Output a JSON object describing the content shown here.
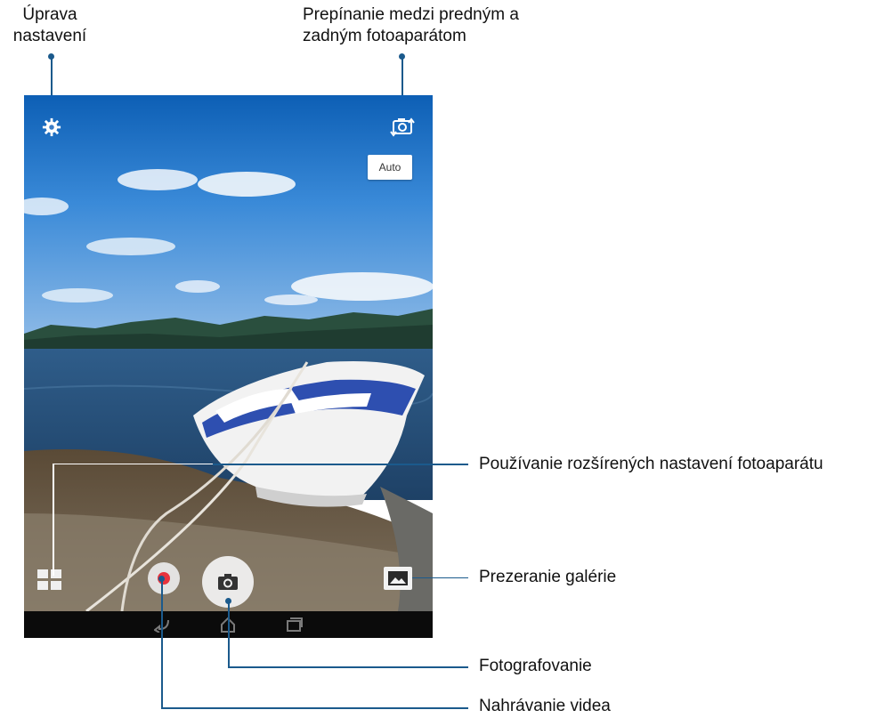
{
  "callouts": {
    "settings": {
      "line1": "Úprava",
      "line2": "nastavení"
    },
    "switch_camera": {
      "line1": "Prepínanie medzi predným a",
      "line2": "zadným fotoaparátom"
    },
    "advanced": "Používanie rozšírených nastavení fotoaparátu",
    "gallery": "Prezeranie galérie",
    "photo": "Fotografovanie",
    "video": "Nahrávanie videa"
  },
  "camera_ui": {
    "mode_button": "Auto",
    "icons": {
      "settings": "gear-icon",
      "switch": "camera-switch-icon",
      "advanced": "grid-modes-icon",
      "video": "record-icon",
      "shutter": "camera-icon",
      "gallery": "gallery-icon",
      "nav_back": "back-icon",
      "nav_home": "home-icon",
      "nav_recent": "recent-apps-icon"
    }
  },
  "colors": {
    "callout_line": "#1b5a8c",
    "record_red": "#e8333c",
    "navbar": "#0b0b0b"
  }
}
